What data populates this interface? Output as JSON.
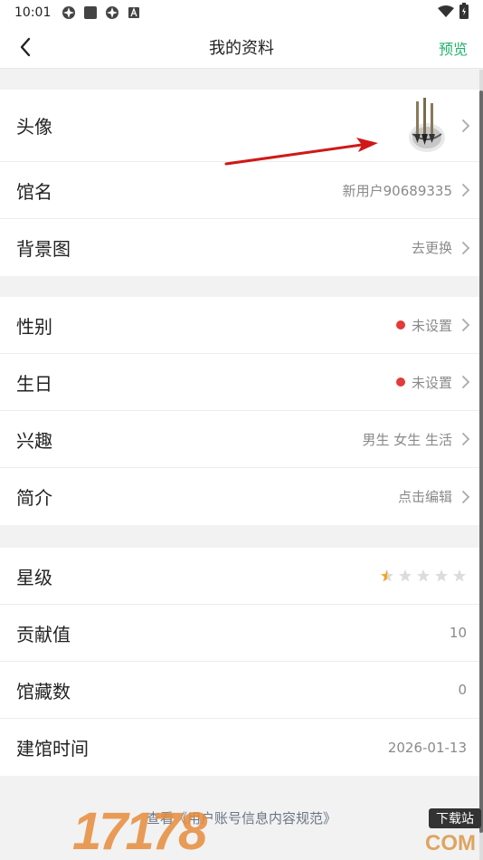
{
  "status_bar": {
    "time": "10:01"
  },
  "header": {
    "title": "我的资料",
    "action": "预览"
  },
  "section1": [
    {
      "label": "头像"
    },
    {
      "label": "馆名",
      "value": "新用户90689335"
    },
    {
      "label": "背景图",
      "value": "去更换"
    }
  ],
  "section2": [
    {
      "label": "性别",
      "value": "未设置"
    },
    {
      "label": "生日",
      "value": "未设置"
    },
    {
      "label": "兴趣",
      "value": "男生 女生 生活"
    },
    {
      "label": "简介",
      "value": "点击编辑"
    }
  ],
  "section3": [
    {
      "label": "星级",
      "stars_filled": 0.5,
      "stars_total": 5
    },
    {
      "label": "贡献值",
      "value": "10"
    },
    {
      "label": "馆藏数",
      "value": "0"
    },
    {
      "label": "建馆时间",
      "value": "2026-01-13"
    }
  ],
  "footer": {
    "text": "查看《用户账号信息内容规范》"
  },
  "watermark": {
    "number": "17178",
    "badge": "下载站",
    "domain": "COM"
  },
  "colors": {
    "accent": "#20b26a",
    "alert": "#e33a3a",
    "annotation": "#d01818"
  }
}
